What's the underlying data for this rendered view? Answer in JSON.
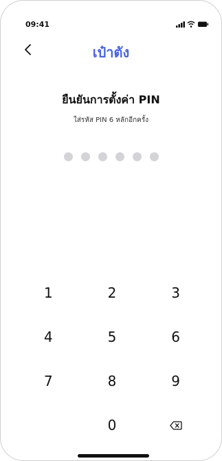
{
  "status_bar": {
    "time": "09:41",
    "icons": [
      "signal-icon",
      "wifi-icon",
      "battery-icon"
    ]
  },
  "header": {
    "back_icon": "chevron-left-icon",
    "title": "เป๋าตัง"
  },
  "confirm": {
    "title": "ยืนยันการตั้งค่า PIN",
    "subtitle": "ใส่รหัส PIN 6 หลักอีกครั้ง"
  },
  "pin": {
    "length": 6,
    "entered": 0
  },
  "keypad": {
    "keys": [
      "1",
      "2",
      "3",
      "4",
      "5",
      "6",
      "7",
      "8",
      "9",
      "",
      "0",
      "delete"
    ],
    "delete_icon": "backspace-icon"
  },
  "colors": {
    "accent": "#4a64e0",
    "dot_empty": "#d4d4d8",
    "text": "#111111"
  }
}
